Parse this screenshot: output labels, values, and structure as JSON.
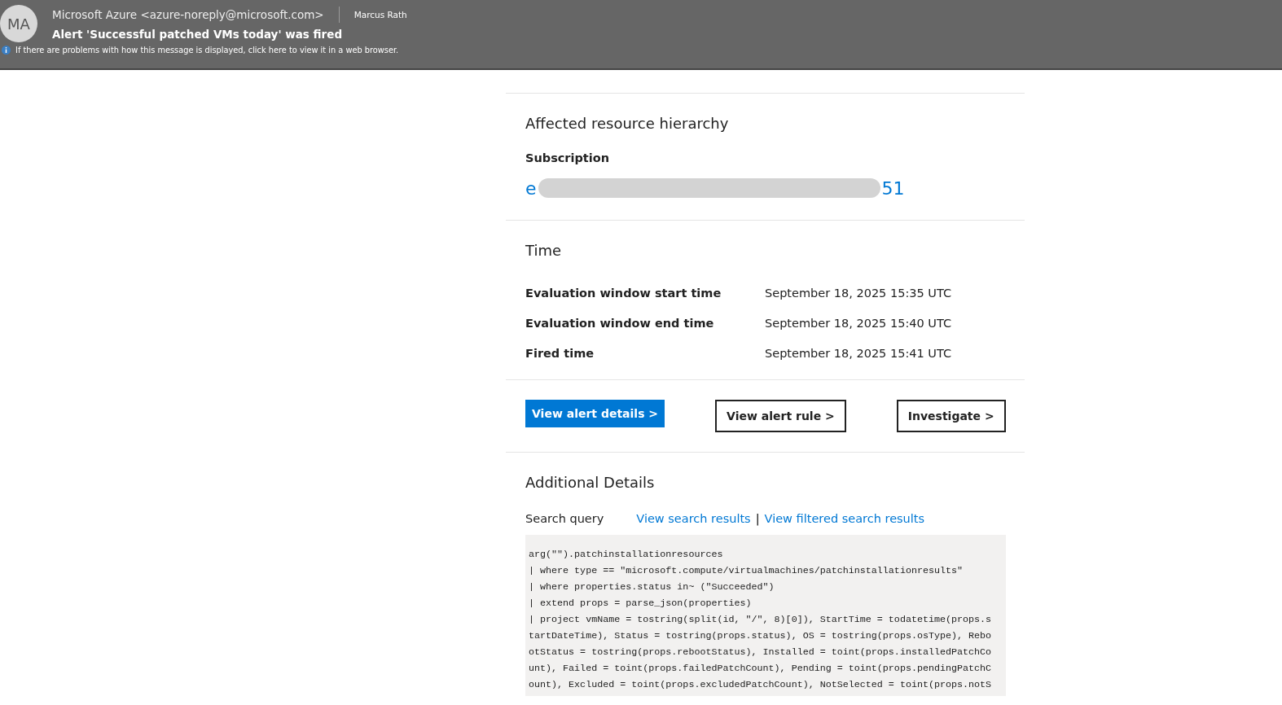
{
  "header": {
    "avatar": "MA",
    "sender": "Microsoft Azure <azure-noreply@microsoft.com>",
    "recipient": "Marcus Rath",
    "subject": "Alert 'Successful patched VMs today' was fired",
    "info": "If there are problems with how this message is displayed, click here to view it in a web browser."
  },
  "hierarchy": {
    "title": "Affected resource hierarchy",
    "label": "Subscription",
    "start": "e",
    "end": "51",
    "redacted": true
  },
  "time": {
    "title": "Time",
    "rows": [
      {
        "label": "Evaluation window start time",
        "value": "September 18, 2025 15:35 UTC"
      },
      {
        "label": "Evaluation window end time",
        "value": "September 18, 2025 15:40 UTC"
      },
      {
        "label": "Fired time",
        "value": "September 18, 2025 15:41 UTC"
      }
    ]
  },
  "buttons": [
    {
      "label": "View alert details >",
      "kind": "primary"
    },
    {
      "label": "View alert rule >",
      "kind": "outline"
    },
    {
      "label": "Investigate >",
      "kind": "outline"
    }
  ],
  "details": {
    "title": "Additional Details",
    "label": "Search query",
    "links": [
      "View search results",
      "View filtered search results"
    ],
    "separator": "|",
    "query": [
      "arg(\"\").patchinstallationresources",
      "| where type == \"microsoft.compute/virtualmachines/patchinstallationresults\"",
      "| where properties.status in~ (\"Succeeded\")",
      "| extend props = parse_json(properties)",
      "| project vmName = tostring(split(id, \"/\", 8)[0]), StartTime = todatetime(props.s",
      "tartDateTime), Status = tostring(props.status), OS = tostring(props.osType), Rebo",
      "otStatus = tostring(props.rebootStatus), Installed = toint(props.installedPatchCo",
      "unt), Failed = toint(props.failedPatchCount), Pending = toint(props.pendingPatchC",
      "ount), Excluded = toint(props.excludedPatchCount), NotSelected = toint(props.notS"
    ]
  }
}
